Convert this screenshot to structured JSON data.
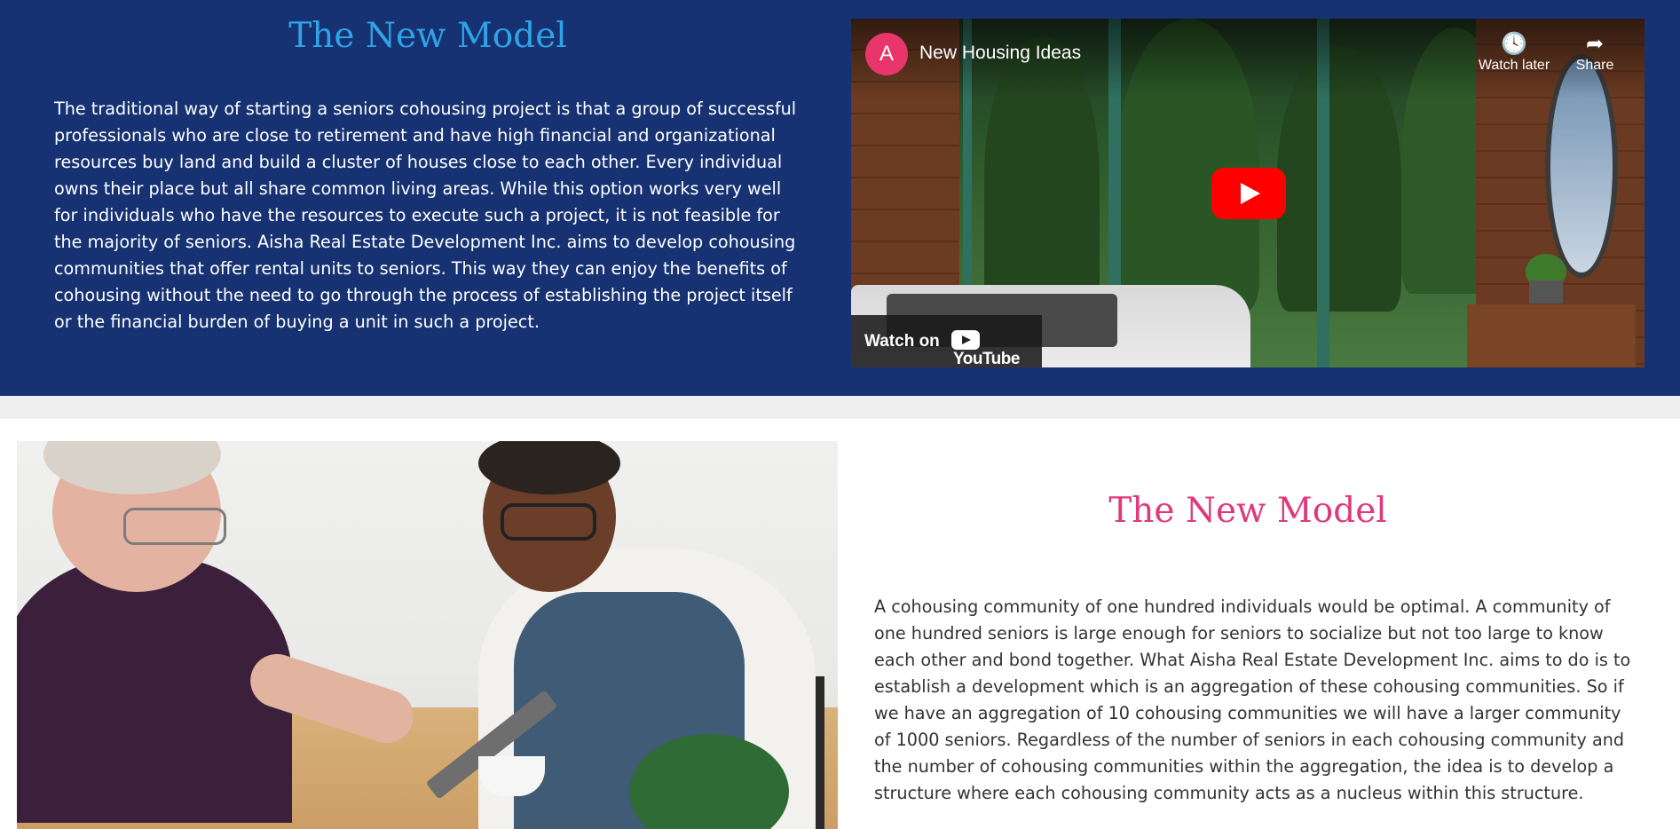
{
  "section_one": {
    "title": "The New Model",
    "title_color": "#2fa3e6",
    "background_color": "#163272",
    "paragraph": "The traditional way of starting a seniors cohousing project is that a group of successful professionals who are close to retirement and have high financial and organizational resources buy land and build a cluster of houses close to each other. Every individual owns their place but all share common living areas. While this option works very well for individuals who have the resources to execute such a project, it is not feasible for the majority of seniors. Aisha Real Estate Development Inc. aims to develop cohousing communities that offer rental units to seniors. This way they can enjoy the benefits of cohousing without the need to go through the process of establishing the project itself or the financial burden of buying a unit in such a project."
  },
  "video": {
    "channel_initial": "A",
    "title": "New Housing Ideas",
    "watch_later_label": "Watch later",
    "share_label": "Share",
    "watch_on_label": "Watch on",
    "youtube_label": "YouTube",
    "play_icon": "play-icon",
    "clock_icon": "clock-icon",
    "share_icon": "share-arrow-icon",
    "play_color": "#ff0000",
    "avatar_color": "#e8356b"
  },
  "section_two": {
    "title": "The New Model",
    "title_color": "#e0387c",
    "paragraph": "A cohousing community of one hundred individuals would be optimal. A community of one hundred seniors is large enough for seniors to socialize but not too large to know each other and bond together. What Aisha Real Estate Development Inc. aims to do is to establish a development which is an aggregation of these cohousing communities. So if we have an aggregation of 10 cohousing communities we will have a larger community of 1000 seniors. Regardless of the number of seniors in each cohousing community and the number of cohousing communities within the aggregation, the idea is to develop a structure where each cohousing community acts as a nucleus within this structure."
  }
}
